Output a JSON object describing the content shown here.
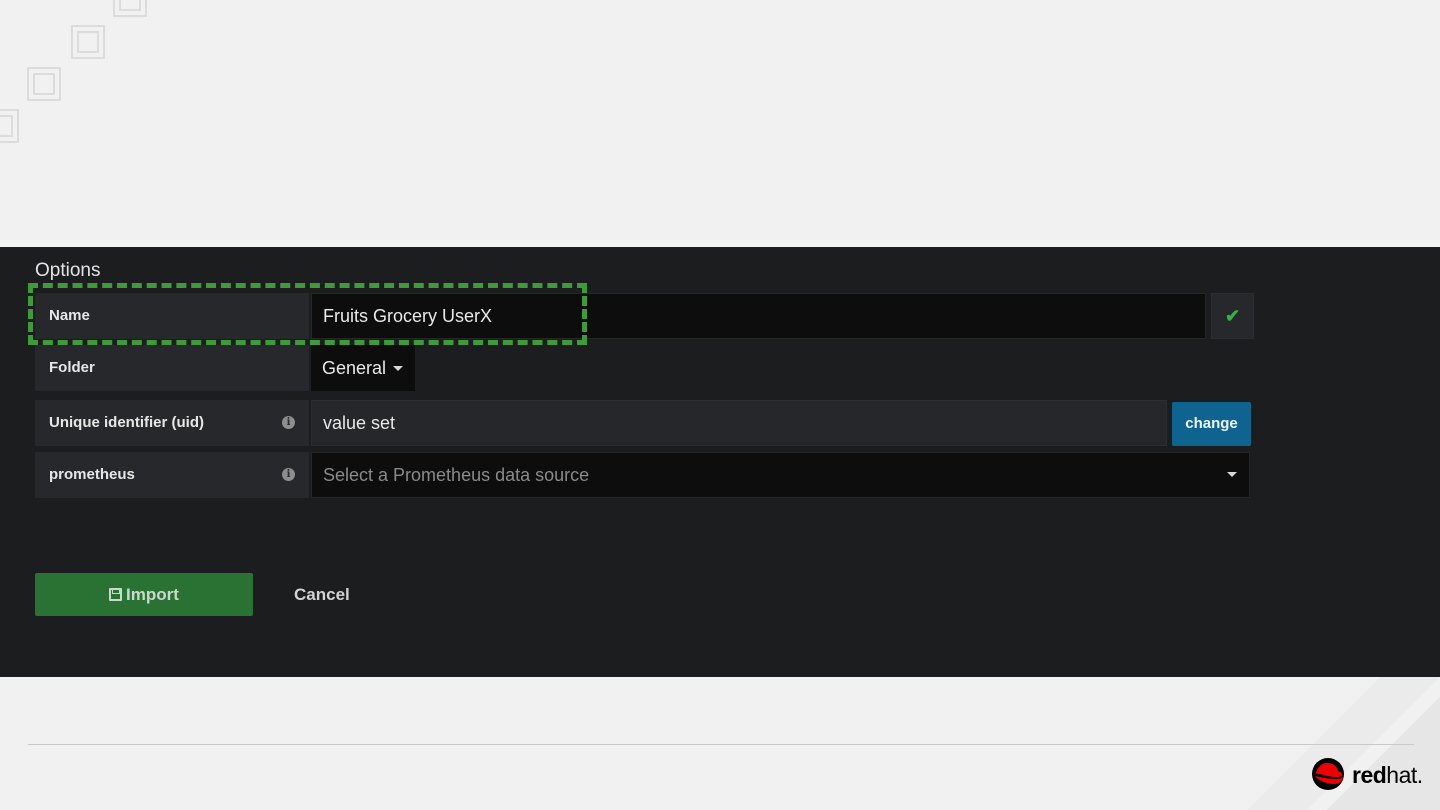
{
  "options": {
    "title": "Options",
    "name": {
      "label": "Name",
      "value": "Fruits Grocery UserX",
      "valid_icon": "check-icon"
    },
    "folder": {
      "label": "Folder",
      "value": "General"
    },
    "uid": {
      "label": "Unique identifier (uid)",
      "value": "value set",
      "button": "change",
      "info_icon": "info-icon"
    },
    "prometheus": {
      "label": "prometheus",
      "placeholder": "Select a Prometheus data source",
      "info_icon": "info-icon"
    }
  },
  "actions": {
    "import_label": "Import",
    "cancel_label": "Cancel"
  },
  "brand": {
    "logo_text_bold": "red",
    "logo_text_light": "hat."
  },
  "colors": {
    "accent_green": "#2a7234",
    "highlight_dash": "#3f9a3a",
    "change_blue": "#0f638f",
    "logo_red": "#e00"
  }
}
